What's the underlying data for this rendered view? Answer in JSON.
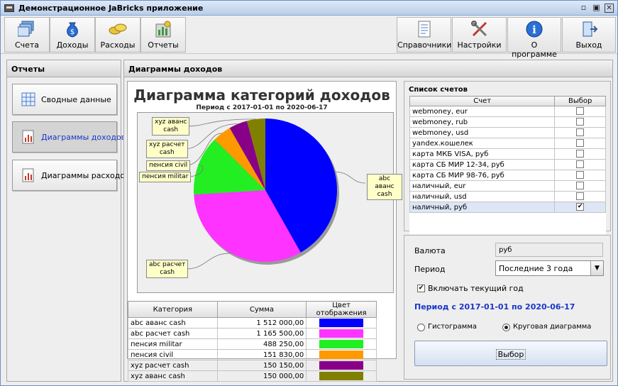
{
  "window": {
    "title": "Демонстрационное JaBricks приложение"
  },
  "toolbar": {
    "left": [
      {
        "label": "Счета",
        "icon": "accounts-icon"
      },
      {
        "label": "Доходы",
        "icon": "money-bag-icon"
      },
      {
        "label": "Расходы",
        "icon": "coins-icon"
      },
      {
        "label": "Отчеты",
        "icon": "reports-icon"
      }
    ],
    "right": [
      {
        "label": "Справочники",
        "icon": "directory-icon"
      },
      {
        "label": "Настройки",
        "icon": "tools-icon"
      },
      {
        "label": "О программе",
        "icon": "info-icon"
      },
      {
        "label": "Выход",
        "icon": "exit-icon"
      }
    ]
  },
  "left_panel": {
    "header": "Отчеты",
    "items": [
      {
        "label": "Сводные данные",
        "active": false
      },
      {
        "label": "Диаграммы доходов",
        "active": true
      },
      {
        "label": "Диаграммы расходов",
        "active": false
      }
    ]
  },
  "right_panel": {
    "header": "Диаграммы доходов"
  },
  "chart_data": {
    "type": "pie",
    "title": "Диаграмма категорий доходов",
    "subtitle": "Период с 2017-01-01 по 2020-06-17",
    "categories": [
      "abc аванс cash",
      "abc расчет cash",
      "пенсия militar",
      "пенсия civil",
      "xyz расчет cash",
      "xyz аванс cash"
    ],
    "values": [
      1512000,
      1165500,
      488250,
      151830,
      150150,
      150000
    ],
    "colors": [
      "#0000ff",
      "#ff33ff",
      "#22ee22",
      "#ff9900",
      "#880088",
      "#808000"
    ],
    "labels": [
      "abc аванс\ncash",
      "abc расчет\ncash",
      "пенсия militar",
      "пенсия civil",
      "xyz расчет\ncash",
      "xyz аванс\ncash"
    ]
  },
  "data_table": {
    "headers": [
      "Категория",
      "Сумма",
      "Цвет отображения"
    ],
    "rows": [
      {
        "category": "abc аванс cash",
        "sum": "1 512 000,00",
        "color": "#0000ff"
      },
      {
        "category": "abc расчет cash",
        "sum": "1 165 500,00",
        "color": "#ff33ff"
      },
      {
        "category": "пенсия militar",
        "sum": "488 250,00",
        "color": "#22ee22"
      },
      {
        "category": "пенсия civil",
        "sum": "151 830,00",
        "color": "#ff9900"
      },
      {
        "category": "xyz расчет cash",
        "sum": "150 150,00",
        "color": "#880088"
      },
      {
        "category": "xyz аванс cash",
        "sum": "150 000,00",
        "color": "#808000"
      }
    ]
  },
  "accounts": {
    "caption": "Список счетов",
    "headers": [
      "Счет",
      "Выбор"
    ],
    "rows": [
      {
        "name": "webmoney, eur",
        "checked": false
      },
      {
        "name": "webmoney, rub",
        "checked": false
      },
      {
        "name": "webmoney, usd",
        "checked": false
      },
      {
        "name": "yandex.кошелек",
        "checked": false
      },
      {
        "name": "карта МКБ VISA, руб",
        "checked": false
      },
      {
        "name": "карта СБ МИР 12-34, руб",
        "checked": false
      },
      {
        "name": "карта СБ МИР 98-76, руб",
        "checked": false
      },
      {
        "name": "наличный, eur",
        "checked": false
      },
      {
        "name": "наличный, usd",
        "checked": false
      },
      {
        "name": "наличный, руб",
        "checked": true
      }
    ]
  },
  "settings": {
    "currency_label": "Валюта",
    "currency_value": "руб",
    "period_label": "Период",
    "period_value": "Последние 3 года",
    "include_current_year_label": "Включать текущий год",
    "include_current_year": true,
    "period_text": "Период с 2017-01-01 по 2020-06-17",
    "radio_histogram": "Гистограмма",
    "radio_pie": "Круговая диаграмма",
    "selected_chart": "pie",
    "select_button": "Выбор",
    "accent_color": "#1a36c9"
  }
}
